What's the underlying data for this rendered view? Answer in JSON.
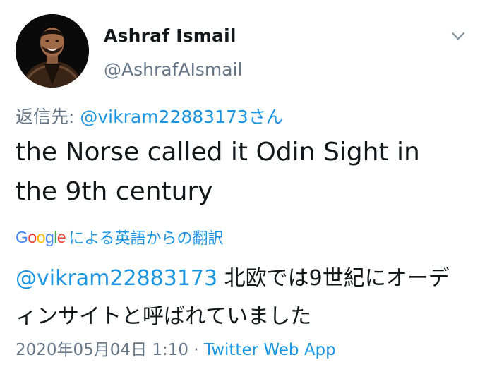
{
  "user": {
    "display_name": "Ashraf Ismail",
    "handle": "@AshrafAIsmail"
  },
  "reply": {
    "prefix": "返信先: ",
    "mention": "@vikram22883173",
    "suffix": "さん"
  },
  "tweet": {
    "text": "the Norse called it Odin Sight in the 9th century"
  },
  "translation": {
    "google_letters": [
      "G",
      "o",
      "o",
      "g",
      "l",
      "e"
    ],
    "label": "による英語からの翻訳",
    "mention": "@vikram22883173",
    "text": " 北欧では9世紀にオーディンサイトと呼ばれていました"
  },
  "meta": {
    "timestamp": "2020年05月04日 1:10",
    "separator": " · ",
    "source": "Twitter Web App"
  },
  "icons": {
    "menu": "chevron-down-icon"
  },
  "colors": {
    "link": "#1b95e0",
    "secondary_text": "#657786",
    "primary_text": "#14171a"
  }
}
